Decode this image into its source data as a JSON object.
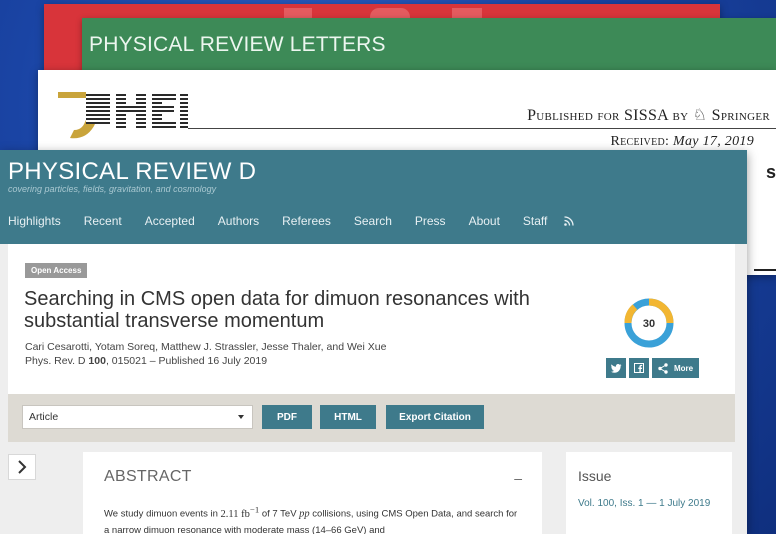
{
  "prl": {
    "title": "PHYSICAL REVIEW LETTERS"
  },
  "jhep": {
    "logo_name": "jhep-logo",
    "published_line": "Published for SISSA by",
    "publisher": "Springer",
    "received_label": "Received:",
    "received_date": "May 17, 2019",
    "peek_text": "s"
  },
  "prd": {
    "title": "PHYSICAL REVIEW D",
    "subtitle": "covering particles, fields, gravitation, and cosmology",
    "nav": [
      "Highlights",
      "Recent",
      "Accepted",
      "Authors",
      "Referees",
      "Search",
      "Press",
      "About",
      "Staff"
    ],
    "rss_icon": "rss-icon",
    "badge": "Open Access",
    "article_title": "Searching in CMS open data for dimuon resonances with substantial transverse momentum",
    "authors": "Cari Cesarotti, Yotam Soreq, Matthew J. Strassler, Jesse Thaler, and Wei Xue",
    "citation_prefix": "Phys. Rev. D ",
    "volume": "100",
    "citation_suffix": ", 015021 – Published 16 July 2019",
    "altmetric_score": "30",
    "share": {
      "twitter": "twitter-icon",
      "facebook": "facebook-icon",
      "share": "share-icon",
      "more_label": "More"
    },
    "toolbar": {
      "select_value": "Article",
      "pdf_label": "PDF",
      "html_label": "HTML",
      "export_label": "Export Citation"
    },
    "expand_icon": "chevron-right-icon",
    "abstract": {
      "heading": "ABSTRACT",
      "toggle": "–",
      "text_1": "We study dimuon events in ",
      "lumi": "2.11 fb",
      "lumi_exp": "−1",
      "text_2": " of 7 TeV ",
      "pp": "pp",
      "text_3": " collisions, using CMS Open Data, and search for a narrow dimuon resonance with moderate mass (14–66 GeV) and"
    },
    "issue": {
      "heading": "Issue",
      "link": "Vol. 100, Iss. 1 — 1 July 2019"
    }
  },
  "colors": {
    "prd_teal": "#3e7a8b",
    "prl_green": "#3d8a57",
    "red_card": "#d8343a",
    "altmetric_yellow": "#f2b632",
    "altmetric_blue": "#3aa1d8"
  }
}
